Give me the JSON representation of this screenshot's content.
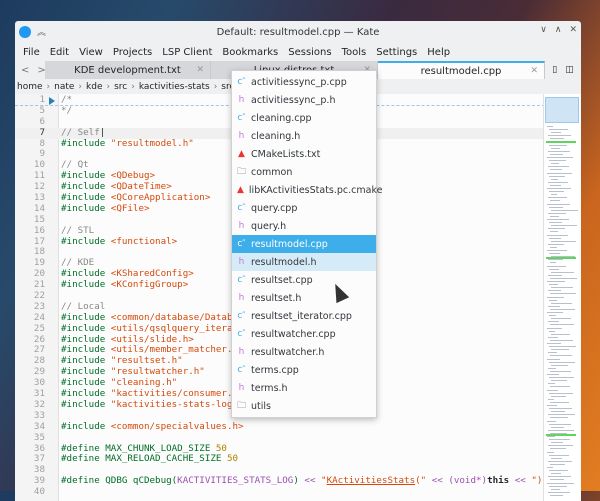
{
  "window": {
    "title": "Default: resultmodel.cpp — Kate"
  },
  "menu": [
    "File",
    "Edit",
    "View",
    "Projects",
    "LSP Client",
    "Bookmarks",
    "Sessions",
    "Tools",
    "Settings",
    "Help"
  ],
  "tabs": [
    {
      "label": "KDE development.txt"
    },
    {
      "label": "Linux distros.txt"
    },
    {
      "label": "resultmodel.cpp",
      "active": true
    }
  ],
  "breadcrumb": [
    "home",
    "nate",
    "kde",
    "src",
    "kactivities-stats",
    "src",
    "resultmodel.cpp"
  ],
  "colors": {
    "accent": "#3daee9",
    "comment": "#898887",
    "preprocessor": "#006e28",
    "string": "#d44a0c"
  },
  "code": [
    {
      "n": "1",
      "h": "<span class='c'>/*</span>"
    },
    {
      "n": "5",
      "h": "<span class='c'>*/</span>"
    },
    {
      "n": "6",
      "h": ""
    },
    {
      "n": "7",
      "h": "<span class='c'>// Self</span>|",
      "cur": true
    },
    {
      "n": "8",
      "h": "<span class='p'>#include </span><span class='s'>\"resultmodel.h\"</span>"
    },
    {
      "n": "9",
      "h": ""
    },
    {
      "n": "10",
      "h": "<span class='c'>// Qt</span>"
    },
    {
      "n": "11",
      "h": "<span class='p'>#include </span><span class='s'>&lt;QDebug&gt;</span>"
    },
    {
      "n": "12",
      "h": "<span class='p'>#include </span><span class='s'>&lt;QDateTime&gt;</span>"
    },
    {
      "n": "13",
      "h": "<span class='p'>#include </span><span class='s'>&lt;QCoreApplication&gt;</span>"
    },
    {
      "n": "14",
      "h": "<span class='p'>#include </span><span class='s'>&lt;QFile&gt;</span>"
    },
    {
      "n": "15",
      "h": ""
    },
    {
      "n": "16",
      "h": "<span class='c'>// STL</span>"
    },
    {
      "n": "17",
      "h": "<span class='p'>#include </span><span class='s'>&lt;functional&gt;</span>"
    },
    {
      "n": "18",
      "h": ""
    },
    {
      "n": "19",
      "h": "<span class='c'>// KDE</span>"
    },
    {
      "n": "20",
      "h": "<span class='p'>#include </span><span class='s'>&lt;KSharedConfig&gt;</span>"
    },
    {
      "n": "21",
      "h": "<span class='p'>#include </span><span class='s'>&lt;KConfigGroup&gt;</span>"
    },
    {
      "n": "22",
      "h": ""
    },
    {
      "n": "23",
      "h": "<span class='c'>// Local</span>"
    },
    {
      "n": "24",
      "h": "<span class='p'>#include </span><span class='s'>&lt;common/database/Database</span>"
    },
    {
      "n": "25",
      "h": "<span class='p'>#include </span><span class='s'>&lt;utils/qsqlquery_iterator</span>"
    },
    {
      "n": "26",
      "h": "<span class='p'>#include </span><span class='s'>&lt;utils/slide.h&gt;</span>"
    },
    {
      "n": "27",
      "h": "<span class='p'>#include </span><span class='s'>&lt;utils/member_matcher.h&gt;</span>"
    },
    {
      "n": "28",
      "h": "<span class='p'>#include </span><span class='s'>\"resultset.h\"</span>"
    },
    {
      "n": "29",
      "h": "<span class='p'>#include </span><span class='s'>\"resultwatcher.h\"</span>"
    },
    {
      "n": "30",
      "h": "<span class='p'>#include </span><span class='s'>\"cleaning.h\"</span>"
    },
    {
      "n": "31",
      "h": "<span class='p'>#include </span><span class='s'>\"kactivities/consumer.h\"</span>"
    },
    {
      "n": "32",
      "h": "<span class='p'>#include </span><span class='s'>\"kactivities-stats-logset</span>"
    },
    {
      "n": "33",
      "h": ""
    },
    {
      "n": "34",
      "h": "<span class='p'>#include </span><span class='s'>&lt;common/specialvalues.h&gt;</span>"
    },
    {
      "n": "35",
      "h": ""
    },
    {
      "n": "36",
      "h": "<span class='p'>#define MAX_CHUNK_LOAD_SIZE </span><span class='num'>50</span>"
    },
    {
      "n": "37",
      "h": "<span class='p'>#define MAX_RELOAD_CACHE_SIZE </span><span class='num'>50</span>"
    },
    {
      "n": "38",
      "h": ""
    },
    {
      "n": "39",
      "h": "<span class='p'>#define QDBG qCDebug(</span><span class='op'>KACTIVITIES_STATS_LOG</span><span class='p'>) </span><span class='op'>&lt;&lt;</span> <span class='s'>\"<u>KActivitiesStats</u>(\"</span> <span class='op'>&lt;&lt; (void*)</span><span class='b'>this</span> <span class='op'>&lt;&lt;</span> <span class='s'>\")\"</span>"
    },
    {
      "n": "40",
      "h": ""
    }
  ],
  "dropdown": [
    {
      "label": "activitiessync_p.cpp",
      "icon": "cpp"
    },
    {
      "label": "activitiessync_p.h",
      "icon": "h"
    },
    {
      "label": "cleaning.cpp",
      "icon": "cpp"
    },
    {
      "label": "cleaning.h",
      "icon": "h"
    },
    {
      "label": "CMakeLists.txt",
      "icon": "cmake"
    },
    {
      "label": "common",
      "icon": "folder"
    },
    {
      "label": "libKActivitiesStats.pc.cmake",
      "icon": "cmake"
    },
    {
      "label": "query.cpp",
      "icon": "cpp"
    },
    {
      "label": "query.h",
      "icon": "h"
    },
    {
      "label": "resultmodel.cpp",
      "icon": "cpp",
      "selected": true
    },
    {
      "label": "resultmodel.h",
      "icon": "h",
      "hovered": true
    },
    {
      "label": "resultset.cpp",
      "icon": "cpp"
    },
    {
      "label": "resultset.h",
      "icon": "h"
    },
    {
      "label": "resultset_iterator.cpp",
      "icon": "cpp"
    },
    {
      "label": "resultwatcher.cpp",
      "icon": "cpp"
    },
    {
      "label": "resultwatcher.h",
      "icon": "h"
    },
    {
      "label": "terms.cpp",
      "icon": "cpp"
    },
    {
      "label": "terms.h",
      "icon": "h"
    },
    {
      "label": "utils",
      "icon": "folder"
    }
  ]
}
